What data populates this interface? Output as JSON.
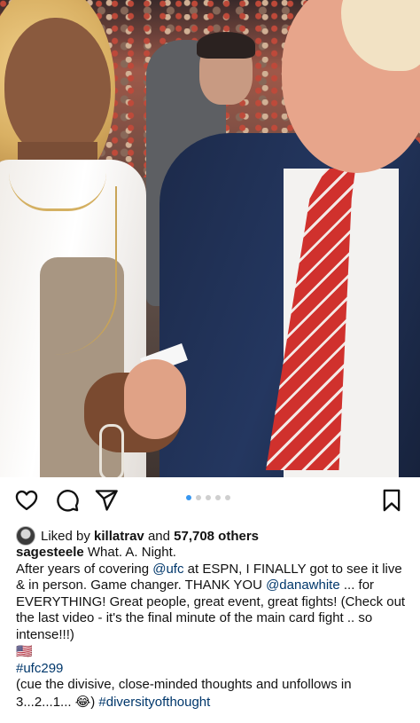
{
  "post": {
    "image_alt": "photo",
    "carousel": {
      "total": 5,
      "active_index": 0
    },
    "icons": {
      "like": "heart-icon",
      "comment": "comment-icon",
      "share": "paper-plane-icon",
      "save": "bookmark-icon"
    },
    "likes": {
      "prefix": "Liked by",
      "user": "killatrav",
      "middle": "and",
      "others": "57,708 others"
    },
    "caption": {
      "username": "sagesteele",
      "line1": " What.  A.  Night.",
      "p2_a": "After years of covering ",
      "p2_mention1": "@ufc",
      "p2_b": " at ESPN, I FINALLY got to see it live & in person.  Game changer.  THANK YOU ",
      "p2_mention2": "@danawhite",
      "p2_c": " ... for EVERYTHING!  Great people, great event, great fights! (Check out the last video - it's the final minute of the main card fight .. so intense!!!)",
      "flag": "🇺🇸",
      "hashtag1": "#ufc299",
      "p5_a": "(cue the divisive, close-minded thoughts and unfollows in 3...2...1... ",
      "laugh": "😂",
      "p5_b": ") ",
      "hashtag2": "#diversityofthought"
    }
  }
}
